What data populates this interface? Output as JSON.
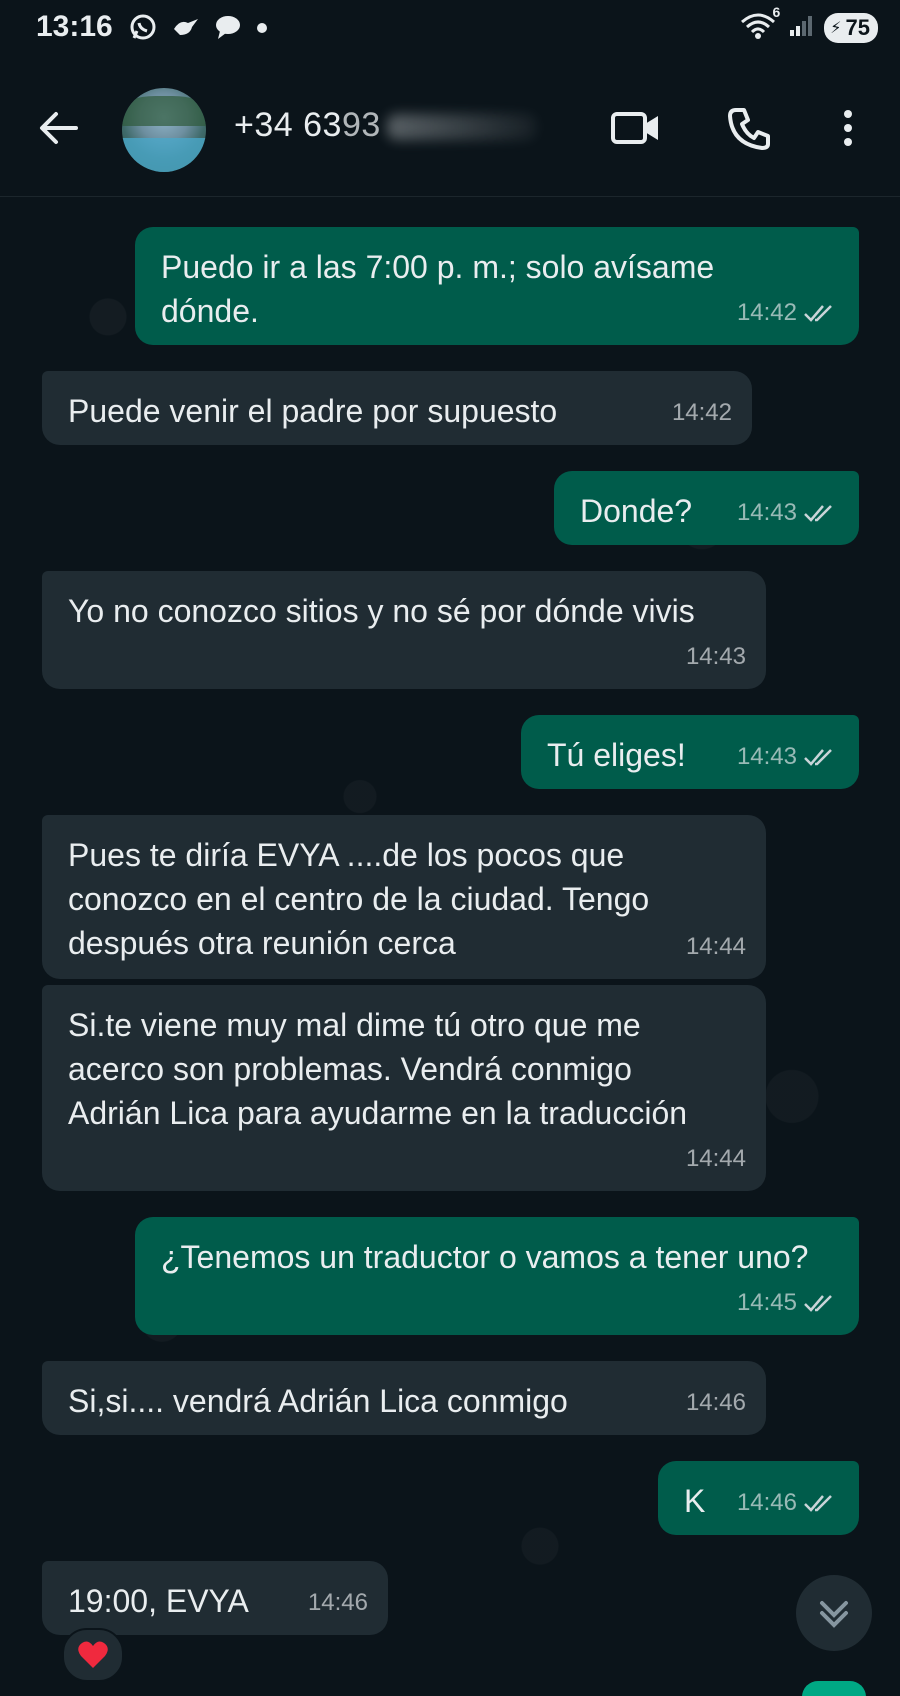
{
  "status_bar": {
    "time": "13:16",
    "network": "6",
    "battery": "75",
    "icons": [
      "whatsapp-icon",
      "bird-icon",
      "chat-bubble-icon",
      "dot-icon",
      "wifi-icon",
      "signal-icon",
      "battery-icon"
    ]
  },
  "header": {
    "contact_name": "+34 63",
    "contact_name_partial": "93",
    "icons": [
      "back-arrow-icon",
      "video-call-icon",
      "phone-icon",
      "more-vert-icon"
    ]
  },
  "messages": [
    {
      "dir": "out",
      "text": "Puedo ir a las 7:00 p. m.; solo avísame dónde.",
      "time": "14:42",
      "read": true
    },
    {
      "dir": "in",
      "text": "Puede venir el padre por supuesto",
      "time": "14:42"
    },
    {
      "dir": "out",
      "text": "Donde?",
      "time": "14:43",
      "read": true
    },
    {
      "dir": "in",
      "text": "Yo no conozco sitios y no sé por dónde vivis",
      "time": "14:43"
    },
    {
      "dir": "out",
      "text": "Tú eliges!",
      "time": "14:43",
      "read": true
    },
    {
      "dir": "in",
      "text": "Pues te diría EVYA ....de los pocos que conozco en el centro de la ciudad. Tengo después otra reunión cerca",
      "time": "14:44"
    },
    {
      "dir": "in",
      "text": "Si.te viene muy mal dime tú otro que me acerco son problemas. Vendrá conmigo Adrián Lica para ayudarme en la traducción",
      "time": "14:44"
    },
    {
      "dir": "out",
      "text": "¿Tenemos un traductor o vamos a tener uno?",
      "time": "14:45",
      "read": true
    },
    {
      "dir": "in",
      "text": "Si,si.... vendrá Adrián Lica conmigo",
      "time": "14:46"
    },
    {
      "dir": "out",
      "text": "K",
      "time": "14:46",
      "read": true
    },
    {
      "dir": "in",
      "text": "19:00, EVYA",
      "time": "14:46",
      "reaction": "❤️"
    }
  ],
  "colors": {
    "background": "#0b141a",
    "outgoing_bubble": "#005c4b",
    "incoming_bubble": "#202c33",
    "accent": "#00a884"
  }
}
